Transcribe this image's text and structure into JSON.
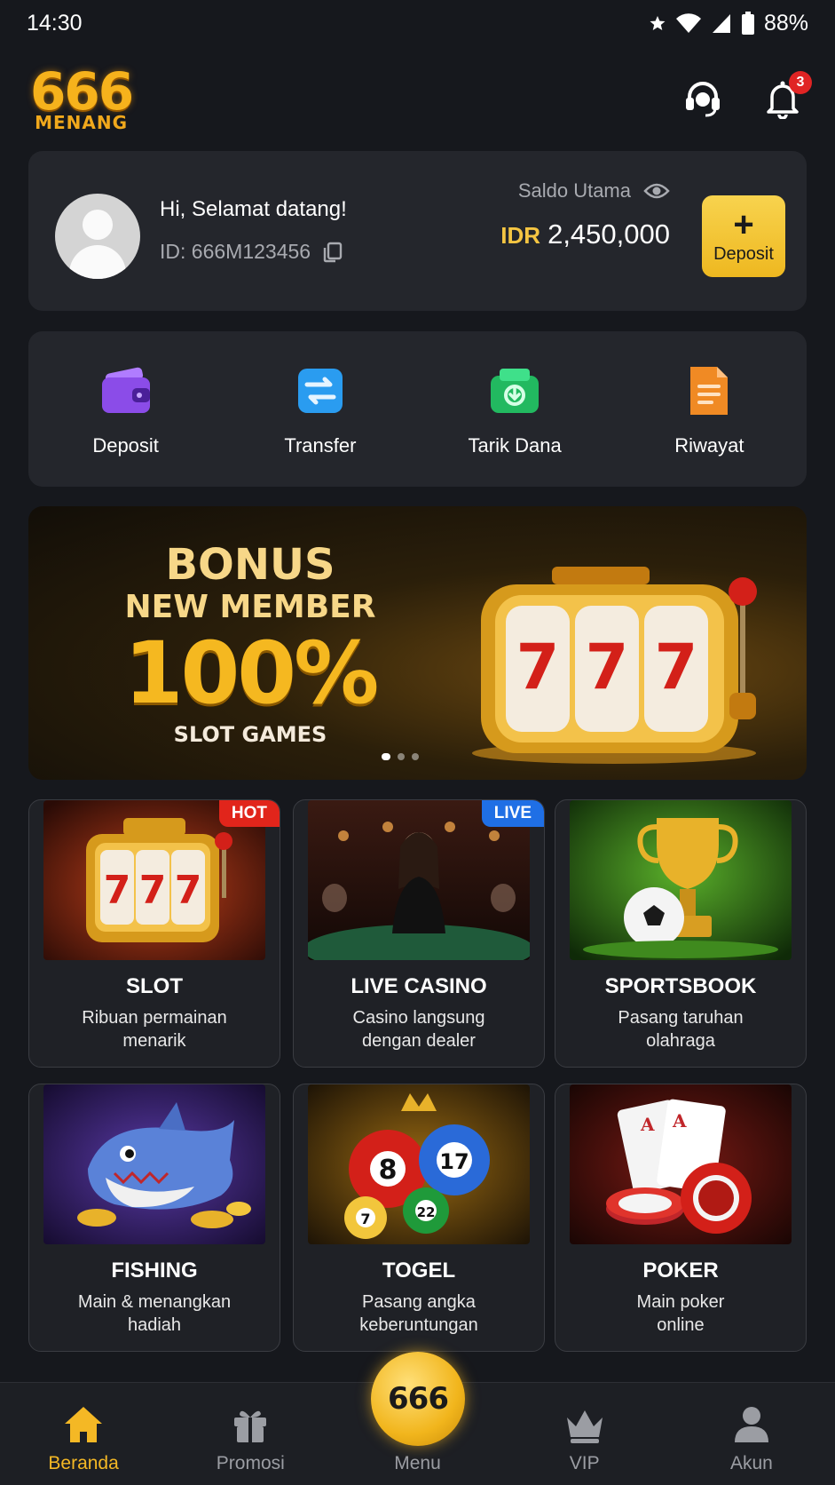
{
  "status_bar": {
    "time": "14:30",
    "battery": "88%"
  },
  "header": {
    "logo_number": "666",
    "logo_word": "MENANG",
    "notification_count": "3",
    "icons": [
      "headset-icon",
      "bell-icon"
    ]
  },
  "profile": {
    "greeting": "Hi, Selamat datang!",
    "user_id": "ID: 666M123456",
    "balance_label": "Saldo Utama",
    "currency": "IDR",
    "balance": "2,450,000",
    "deposit_label": "Deposit",
    "deposit_symbol": "+"
  },
  "quick_actions": [
    {
      "label": "Deposit",
      "icon": "wallet-icon",
      "color": "#8b4ce8"
    },
    {
      "label": "Transfer",
      "icon": "transfer-icon",
      "color": "#2a9cf0"
    },
    {
      "label": "Tarik Dana",
      "icon": "withdraw-icon",
      "color": "#22b960"
    },
    {
      "label": "Riwayat",
      "icon": "history-icon",
      "color": "#f08a24"
    }
  ],
  "banner": {
    "line1": "BONUS",
    "line2": "NEW MEMBER",
    "percent": "100%",
    "line4": "SLOT GAMES",
    "slide_count": 3,
    "active_slide": 1
  },
  "games": [
    {
      "title": "SLOT",
      "desc_line1": "Ribuan permainan",
      "desc_line2": "menarik",
      "tag": "HOT"
    },
    {
      "title": "LIVE CASINO",
      "desc_line1": "Casino langsung",
      "desc_line2": "dengan dealer",
      "tag": "LIVE"
    },
    {
      "title": "SPORTSBOOK",
      "desc_line1": "Pasang taruhan",
      "desc_line2": "olahraga",
      "tag": ""
    },
    {
      "title": "FISHING",
      "desc_line1": "Main & menangkan",
      "desc_line2": "hadiah",
      "tag": ""
    },
    {
      "title": "TOGEL",
      "desc_line1": "Pasang angka",
      "desc_line2": "keberuntungan",
      "tag": ""
    },
    {
      "title": "POKER",
      "desc_line1": "Main poker",
      "desc_line2": "online",
      "tag": ""
    }
  ],
  "togel_balls": [
    "8",
    "17",
    "7",
    "22"
  ],
  "slot_symbol": "7",
  "bottom_nav": {
    "items": [
      {
        "label": "Beranda",
        "icon": "home-icon",
        "active": true
      },
      {
        "label": "Promosi",
        "icon": "gift-icon",
        "active": false
      },
      {
        "label": "Menu",
        "icon": "menu-fab",
        "active": false
      },
      {
        "label": "VIP",
        "icon": "crown-icon",
        "active": false
      },
      {
        "label": "Akun",
        "icon": "user-icon",
        "active": false
      }
    ],
    "fab_label": "666"
  },
  "colors": {
    "accent": "#f4b825",
    "background": "#16181d",
    "card": "#24262c"
  }
}
